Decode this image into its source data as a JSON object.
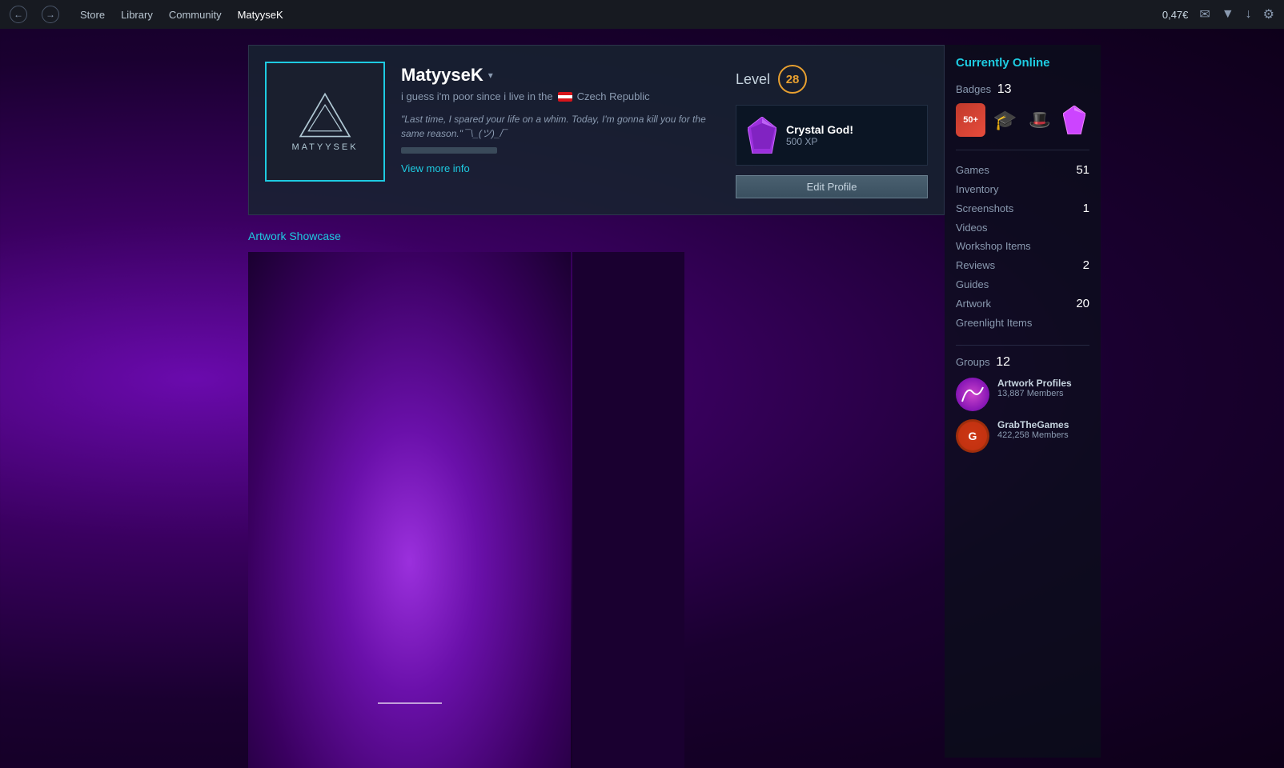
{
  "topbar": {
    "back_btn": "←",
    "forward_btn": "→",
    "nav_items": [
      {
        "label": "Store",
        "active": false
      },
      {
        "label": "Library",
        "active": false
      },
      {
        "label": "Community",
        "active": false
      },
      {
        "label": "MatyyseK",
        "active": true
      }
    ],
    "balance": "0,47€",
    "icons": [
      "✉",
      "▼",
      "↓",
      "⚙"
    ]
  },
  "profile": {
    "username": "MatyyseK",
    "dropdown_arrow": "▾",
    "location_text": "i guess i'm poor since i live in the",
    "country": "Czech Republic",
    "quote": "\"Last time, I spared your life on a whim. Today, I'm gonna kill you for the same reason.\" ¯\\_(ツ)_/¯",
    "view_more": "View more info",
    "avatar_text": "MATYYSEK",
    "level_label": "Level",
    "level_number": "28",
    "crystal_name": "Crystal God!",
    "crystal_xp": "500 XP",
    "edit_profile_label": "Edit Profile"
  },
  "showcase": {
    "title": "Artwork Showcase"
  },
  "sidebar": {
    "online_status": "Currently Online",
    "badges_label": "Badges",
    "badges_count": "13",
    "games_label": "Games",
    "games_count": "51",
    "inventory_label": "Inventory",
    "inventory_count": "",
    "screenshots_label": "Screenshots",
    "screenshots_count": "1",
    "videos_label": "Videos",
    "videos_count": "",
    "workshop_label": "Workshop Items",
    "workshop_count": "",
    "reviews_label": "Reviews",
    "reviews_count": "2",
    "guides_label": "Guides",
    "guides_count": "",
    "artwork_label": "Artwork",
    "artwork_count": "20",
    "greenlight_label": "Greenlight Items",
    "greenlight_count": "",
    "groups_label": "Groups",
    "groups_count": "12",
    "groups": [
      {
        "name": "Artwork Profiles",
        "members": "13,887 Members",
        "type": "artwork"
      },
      {
        "name": "GrabTheGames",
        "members": "422,258 Members",
        "type": "grab"
      }
    ]
  }
}
